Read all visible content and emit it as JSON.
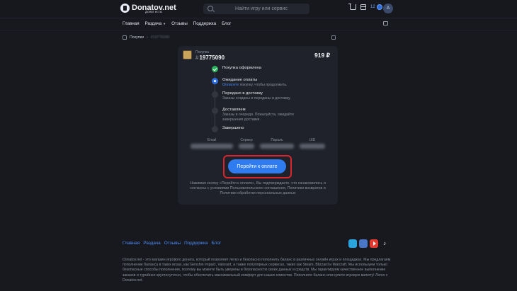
{
  "header": {
    "logo_title": "Donatov.net",
    "logo_subtitle": "Донат есть!",
    "search_placeholder": "Найти игру или сервис",
    "balance": "12",
    "avatar_letter": "A"
  },
  "nav": {
    "items": [
      "Главная",
      "Раздача",
      "Отзывы",
      "Поддержка",
      "Блог"
    ]
  },
  "breadcrumbs": {
    "purchases": "Покупки",
    "separator": "›",
    "order": "#19775090"
  },
  "order": {
    "type_label": "Покупка",
    "hash": "#",
    "number": "19775090",
    "price": "919 ₽"
  },
  "steps": [
    {
      "title": "Покупка оформлена",
      "status": "done"
    },
    {
      "title": "Ожидание оплаты",
      "status": "active",
      "desc_link": "Оплатите",
      "desc_rest": " покупку, чтобы продолжить."
    },
    {
      "title": "Передано в доставку",
      "status": "pending",
      "desc": "Заказы созданы и переданы в доставку."
    },
    {
      "title": "Доставляем",
      "status": "pending",
      "desc": "Заказы в очереди. Пожалуйста, ожидайте завершения доставки."
    },
    {
      "title": "Завершено",
      "status": "pending"
    }
  ],
  "fields": [
    {
      "label": "Email"
    },
    {
      "label": "Сервер"
    },
    {
      "label": "Пароль"
    },
    {
      "label": "UID"
    }
  ],
  "pay_button": "Перейти к оплате",
  "agreement_note": "Нажимая кнопку «Перейти к оплате», Вы подтверждаете, что ознакомились и согласны с условиями Пользовательского соглашения, Политики возвратов и Политики обработки персональных данных",
  "footer": {
    "nav": [
      "Главная",
      "Раздача",
      "Отзывы",
      "Поддержка",
      "Блог"
    ],
    "socials": [
      "telegram-icon",
      "vk-icon",
      "youtube-icon",
      "tiktok-icon"
    ],
    "about": "Donatov.net - это магазин игрового доната, который позволяет легко и безопасно пополнить баланс в различных онлайн играх и площадках. Мы предлагаем пополнение баланса в таких играх, как Genshin Impact, Valorant, а также популярных сервисах, таких как Steam, Blizzard и Warcraft. Мы используем только безопасные способы пополнения, поэтому вы можете быть уверены в безопасности своих данных и средств. Мы гарантируем качественное выполнение заказов и турийнее круглосуточно, чтобы обеспечить максимальный комфорт для наших клиентов. Пополните баланс или купите игровую валюту! Легко с Donatov.net."
  },
  "colors": {
    "accent": "#2f7bf0",
    "success": "#2bb35e",
    "highlight_border": "#d9262c",
    "background": "#17191f"
  }
}
